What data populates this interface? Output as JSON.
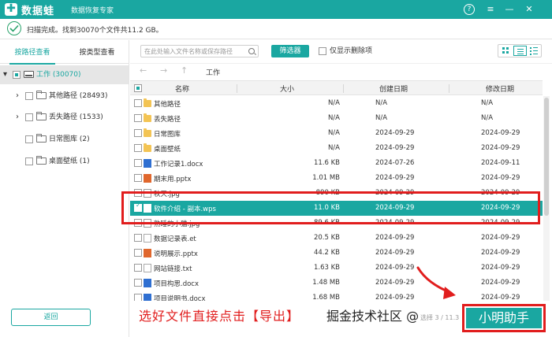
{
  "app": {
    "name": "数据蛙",
    "subtitle": "数据恢复专家",
    "logo_glyph": "✚",
    "help": "?",
    "menu": "≡",
    "minimize": "—",
    "close": "✕"
  },
  "status": {
    "text": "扫描完成。找到30070个文件共11.2 GB。"
  },
  "left": {
    "tabs": [
      "按路径查看",
      "按类型查看"
    ],
    "root": {
      "label": "工作 (30070)"
    },
    "items": [
      {
        "label": "其他路径 (28493)"
      },
      {
        "label": "丢失路径 (1533)"
      },
      {
        "label": "日常图库 (2)"
      },
      {
        "label": "桌面壁纸 (1)"
      }
    ],
    "back_button": "返回"
  },
  "toolbar": {
    "search_placeholder": "在此处输入文件名称或保存路径",
    "filter_button": "筛选器",
    "deleted_only_label": "仅显示删除项"
  },
  "nav": {
    "path": "工作"
  },
  "table": {
    "headers": {
      "name": "名称",
      "size": "大小",
      "created": "创建日期",
      "modified": "修改日期"
    },
    "rows": [
      {
        "icon": "folder",
        "name": "其他路径",
        "size": "N/A",
        "created": "N/A",
        "modified": "N/A"
      },
      {
        "icon": "folder",
        "name": "丢失路径",
        "size": "N/A",
        "created": "N/A",
        "modified": "N/A"
      },
      {
        "icon": "folder",
        "name": "日常图库",
        "size": "N/A",
        "created": "2024-09-29",
        "modified": "2024-09-29"
      },
      {
        "icon": "folder",
        "name": "桌面壁纸",
        "size": "N/A",
        "created": "2024-09-29",
        "modified": "2024-09-29"
      },
      {
        "icon": "doc",
        "name": "工作记录1.docx",
        "size": "11.6 KB",
        "created": "2024-07-26",
        "modified": "2024-09-11"
      },
      {
        "icon": "ppt",
        "name": "期末用.pptx",
        "size": "1.01 MB",
        "created": "2024-09-29",
        "modified": "2024-09-29"
      },
      {
        "icon": "img",
        "name": "秋天.jpg",
        "size": "890 KB",
        "created": "2024-09-29",
        "modified": "2024-09-29"
      },
      {
        "icon": "wps",
        "name": "软件介绍 - 副本.wps",
        "size": "11.0 KB",
        "created": "2024-09-29",
        "modified": "2024-09-29",
        "selected": true
      },
      {
        "icon": "img",
        "name": "熟睡的小猫.jpg",
        "size": "89.6 KB",
        "created": "2024-09-29",
        "modified": "2024-09-29"
      },
      {
        "icon": "et",
        "name": "数据记录表.et",
        "size": "20.5 KB",
        "created": "2024-09-29",
        "modified": "2024-09-29"
      },
      {
        "icon": "ppt",
        "name": "说明展示.pptx",
        "size": "44.2 KB",
        "created": "2024-09-29",
        "modified": "2024-09-29"
      },
      {
        "icon": "txt",
        "name": "网站链接.txt",
        "size": "1.63 KB",
        "created": "2024-09-29",
        "modified": "2024-09-29"
      },
      {
        "icon": "doc",
        "name": "项目构思.docx",
        "size": "1.48 MB",
        "created": "2024-09-29",
        "modified": "2024-09-29"
      },
      {
        "icon": "doc",
        "name": "项目说明书.docx",
        "size": "1.68 MB",
        "created": "2024-09-29",
        "modified": "2024-09-29"
      }
    ]
  },
  "overlay": {
    "caption": "选好文件直接点击【导出】",
    "export_button": "小明助手",
    "community_text": "掘金技术社区 @",
    "watermark": "选择 3 / 11.3"
  },
  "colors": {
    "accent": "#1aa7a1",
    "highlight": "#e11d1d"
  }
}
